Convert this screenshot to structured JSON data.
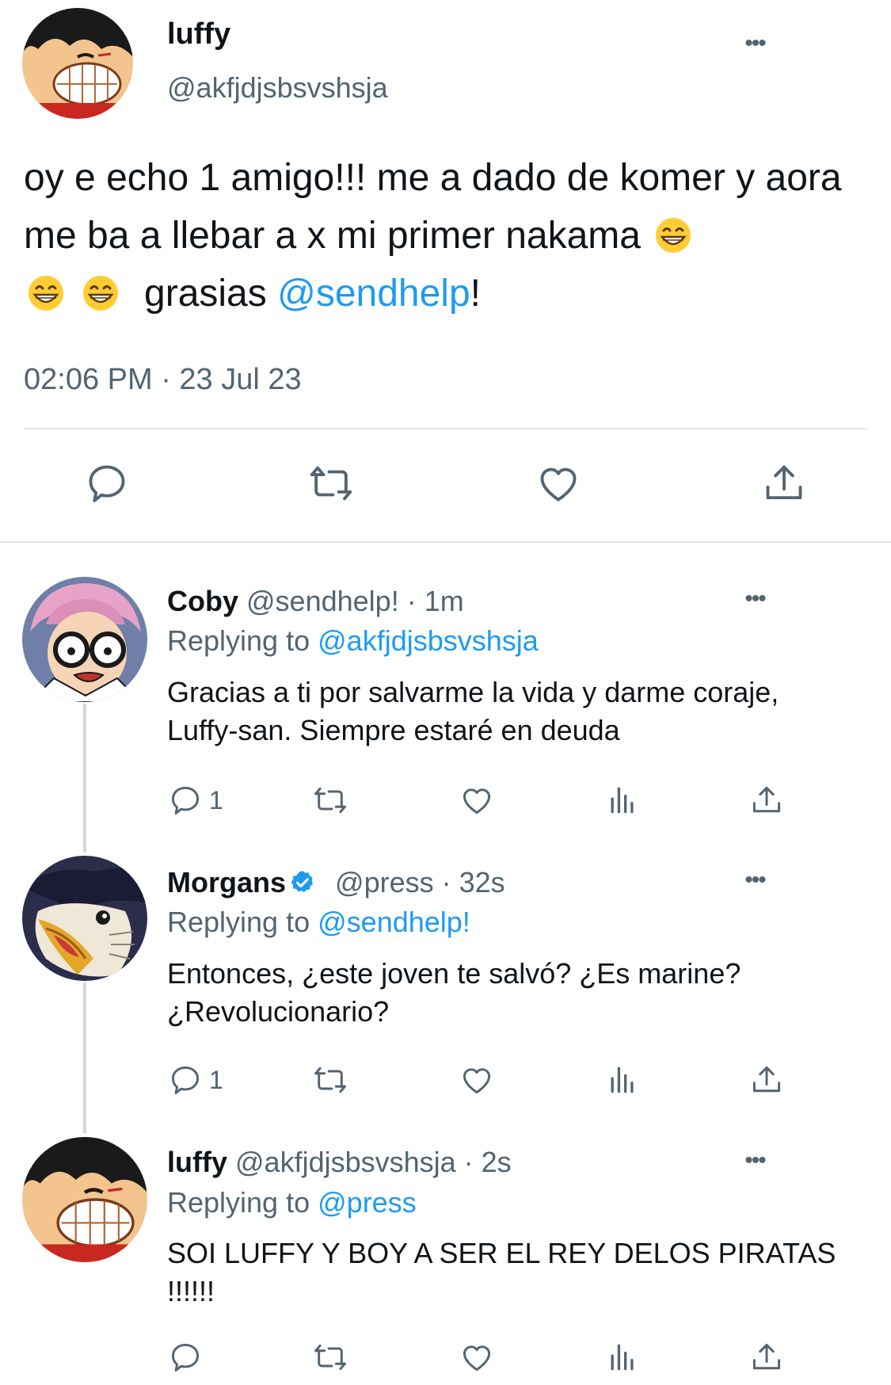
{
  "main_tweet": {
    "name": "luffy",
    "handle": "@akfjdjsbsvshsja",
    "text_part1": "oy e echo 1 amigo!!! me a dado de komer y aora me ba a llebar a x mi primer nakama",
    "text_part2": "grasias",
    "mention": "@sendhelp",
    "text_end": "!",
    "emoji": "grinning-face-emoji",
    "timestamp": "02:06 PM · 23 Jul 23",
    "more_label": "•••",
    "actions": [
      "reply-icon",
      "retweet-icon",
      "like-icon",
      "share-icon"
    ]
  },
  "replies": [
    {
      "name": "Coby",
      "meta": "@sendhelp! · 1m",
      "replying_label": "Replying to",
      "replying_to": "@akfjdjsbsvshsja",
      "body": "Gracias a ti por salvarme la vida y darme coraje, Luffy-san. Siempre estaré en deuda",
      "reply_count": "1",
      "verified": false
    },
    {
      "name": "Morgans",
      "meta": "@press · 32s",
      "replying_label": "Replying to",
      "replying_to": "@sendhelp!",
      "body": "Entonces, ¿este joven te salvó? ¿Es marine? ¿Revolucionario?",
      "reply_count": "1",
      "verified": true
    },
    {
      "name": "luffy",
      "meta": "@akfjdjsbsvshsja · 2s",
      "replying_label": "Replying to",
      "replying_to": "@press",
      "body": "SOI LUFFY Y BOY A SER EL REY DELOS PIRATAS !!!!!!",
      "reply_count": "",
      "verified": false
    }
  ],
  "colors": {
    "link": "#1d9bf0",
    "secondary_text": "#536471",
    "primary_text": "#0f1419",
    "divider": "#e1e6ea",
    "verified": "#1d9bf0"
  }
}
